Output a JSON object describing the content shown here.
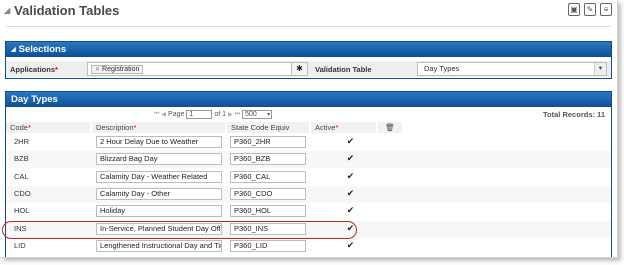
{
  "page": {
    "title": "Validation Tables"
  },
  "header_icons": [
    "save-icon",
    "edit-icon",
    "document-icon"
  ],
  "selections": {
    "title": "Selections",
    "applications_label": "Applications",
    "application_chip": "Registration",
    "validation_table_label": "Validation Table",
    "validation_table_value": "Day Types"
  },
  "day_types": {
    "title": "Day Types",
    "pager": {
      "page_label": "Page",
      "page_value": "1",
      "of_label": "of 1",
      "page_size": "500"
    },
    "total_records": "Total Records: 11",
    "columns": {
      "code": "Code",
      "description": "Description",
      "state_code": "State Code Equiv",
      "active": "Active"
    },
    "rows": [
      {
        "code": "2HR",
        "description": "2 Hour Delay Due to Weather",
        "state": "P360_2HR",
        "active": "✔"
      },
      {
        "code": "BZB",
        "description": "Blizzard Bag Day",
        "state": "P360_BZB",
        "active": "✔"
      },
      {
        "code": "CAL",
        "description": "Calamity Day - Weather Related",
        "state": "P360_CAL",
        "active": "✔"
      },
      {
        "code": "CDO",
        "description": "Calamity Day - Other",
        "state": "P360_CDO",
        "active": "✔"
      },
      {
        "code": "HOL",
        "description": "Holiday",
        "state": "P360_HOL",
        "active": "✔"
      },
      {
        "code": "INS",
        "description": "In-Service, Planned Student Day Off",
        "state": "P360_INS",
        "active": "✔"
      },
      {
        "code": "LID",
        "description": "Lengthened Instructional Day and Tin",
        "state": "P360_LID",
        "active": "✔"
      }
    ]
  },
  "colors": {
    "panel_header": "#0d4f96",
    "highlight": "#c0272d",
    "required": "#cc0000"
  }
}
